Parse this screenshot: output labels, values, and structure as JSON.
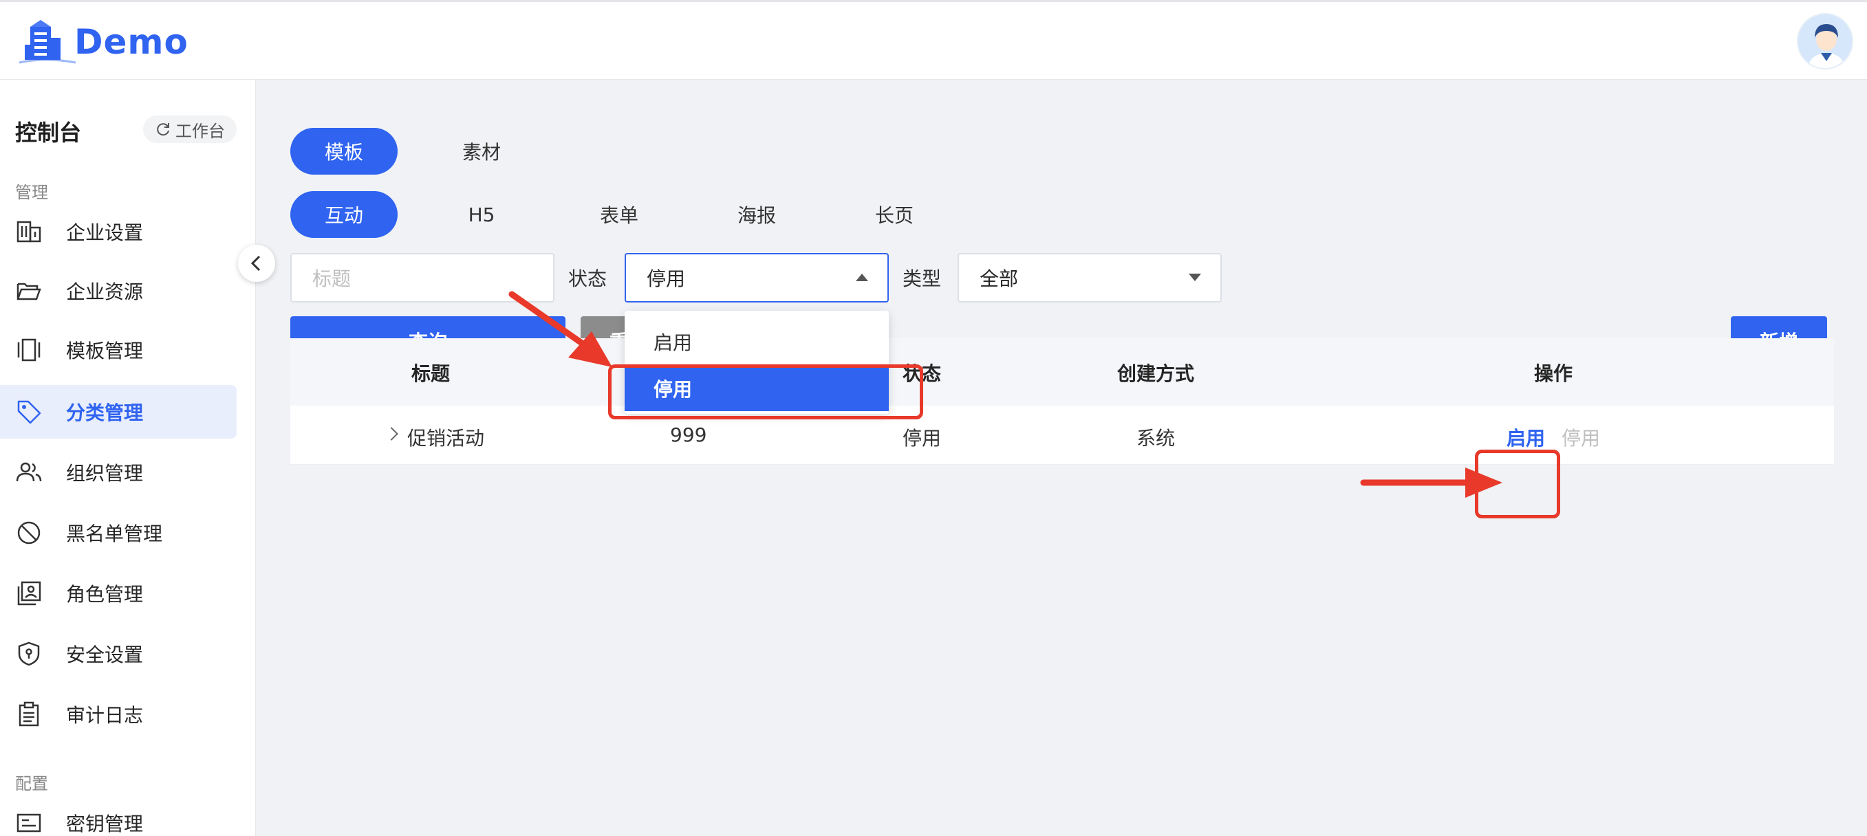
{
  "header": {
    "logo_text": "Demo"
  },
  "sidebar": {
    "title": "控制台",
    "workbench": "工作台",
    "group_manage": "管理",
    "group_config": "配置",
    "items": [
      {
        "label": "企业设置",
        "icon": "building-icon"
      },
      {
        "label": "企业资源",
        "icon": "folder-open-icon"
      },
      {
        "label": "模板管理",
        "icon": "template-icon"
      },
      {
        "label": "分类管理",
        "icon": "tag-icon",
        "active": true
      },
      {
        "label": "组织管理",
        "icon": "users-icon"
      },
      {
        "label": "黑名单管理",
        "icon": "ban-icon"
      },
      {
        "label": "角色管理",
        "icon": "id-card-icon"
      },
      {
        "label": "安全设置",
        "icon": "shield-lock-icon"
      },
      {
        "label": "审计日志",
        "icon": "clipboard-icon"
      },
      {
        "label": "密钥管理",
        "icon": "key-card-icon"
      }
    ]
  },
  "tabs_top": [
    "模板",
    "素材"
  ],
  "tabs_sub": [
    "互动",
    "H5",
    "表单",
    "海报",
    "长页"
  ],
  "filters": {
    "title_placeholder": "标题",
    "status_label": "状态",
    "status_value": "停用",
    "type_label": "类型",
    "type_value": "全部"
  },
  "buttons": {
    "query": "查询",
    "reset": "重",
    "add": "新增"
  },
  "dropdown": {
    "options": [
      "启用",
      "停用"
    ],
    "selected": "停用"
  },
  "table": {
    "headers": [
      "标题",
      "状态",
      "创建方式",
      "操作"
    ],
    "rows": [
      {
        "title": "促销活动",
        "count": "999",
        "status": "停用",
        "method": "系统",
        "actions": [
          "启用",
          "停用"
        ]
      }
    ]
  },
  "colors": {
    "primary": "#2f63f0",
    "annotation": "#e8392a"
  }
}
